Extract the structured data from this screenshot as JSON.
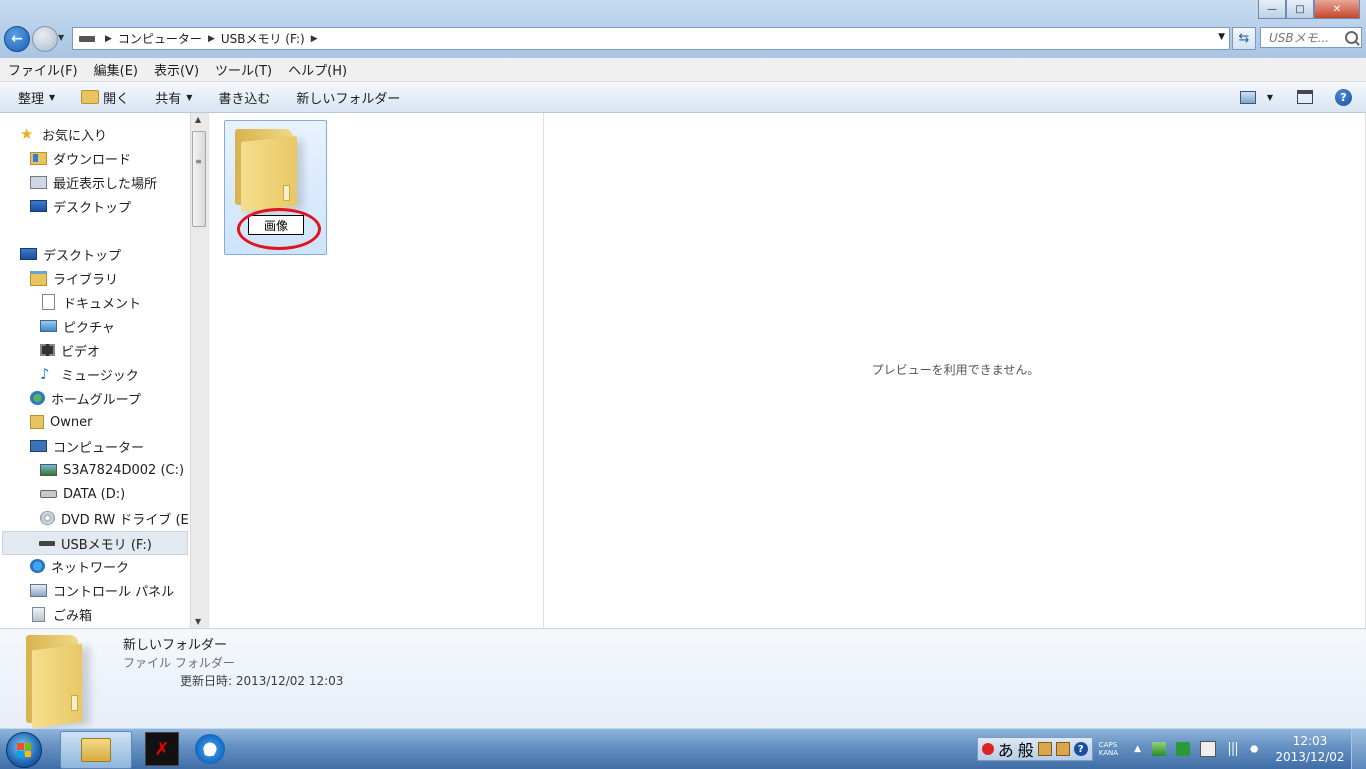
{
  "window": {
    "minimize_icon": "minimize-icon",
    "maximize_icon": "maximize-icon",
    "close_icon": "close-icon"
  },
  "address": {
    "segments": [
      "コンピューター",
      "USBメモリ (F:)"
    ],
    "search_placeholder": "USBメモ..."
  },
  "menu": [
    "ファイル(F)",
    "編集(E)",
    "表示(V)",
    "ツール(T)",
    "ヘルプ(H)"
  ],
  "commands": {
    "organize": "整理",
    "open": "開く",
    "share": "共有",
    "burn": "書き込む",
    "new_folder": "新しいフォルダー"
  },
  "nav": {
    "favorites": "お気に入り",
    "downloads": "ダウンロード",
    "recent": "最近表示した場所",
    "desktop_fav": "デスクトップ",
    "desktop": "デスクトップ",
    "libraries": "ライブラリ",
    "documents": "ドキュメント",
    "pictures": "ピクチャ",
    "videos": "ビデオ",
    "music": "ミュージック",
    "homegroup": "ホームグループ",
    "owner": "Owner",
    "computer": "コンピューター",
    "drive_c": "S3A7824D002 (C:)",
    "drive_d": "DATA (D:)",
    "drive_e": "DVD RW ドライブ (E:)",
    "drive_f": "USBメモリ (F:)",
    "network": "ネットワーク",
    "control_panel": "コントロール パネル",
    "recycle_bin": "ごみ箱"
  },
  "content": {
    "rename_value": "画像",
    "annotation_color": "#e0141a"
  },
  "preview": {
    "message": "プレビューを利用できません。"
  },
  "details": {
    "name": "新しいフォルダー",
    "type": "ファイル フォルダー",
    "modified": "更新日時: 2013/12/02 12:03"
  },
  "taskbar": {
    "ime_mode": "あ",
    "ime_kanji": "般",
    "caps": "CAPS",
    "kana": "KANA",
    "time": "12:03",
    "date": "2013/12/02"
  }
}
